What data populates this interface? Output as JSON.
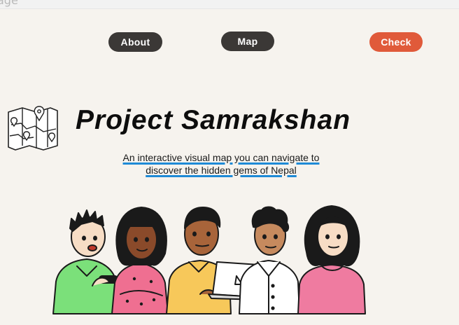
{
  "top_strip": {
    "partial_text": "age"
  },
  "nav": {
    "about_label": "About",
    "map_label": "Map",
    "check_label": "Check"
  },
  "hero": {
    "title": "Project Samrakshan",
    "subtitle": "An interactive visual map you can navigate to discover the hidden gems of Nepal"
  },
  "colors": {
    "background": "#f6f3ee",
    "nav_button": "#3b3836",
    "check_button": "#e05a3a",
    "underline": "#1e8ad6"
  },
  "icons": [
    "folded-map-icon"
  ],
  "illustrations": [
    "group-of-five-people"
  ]
}
